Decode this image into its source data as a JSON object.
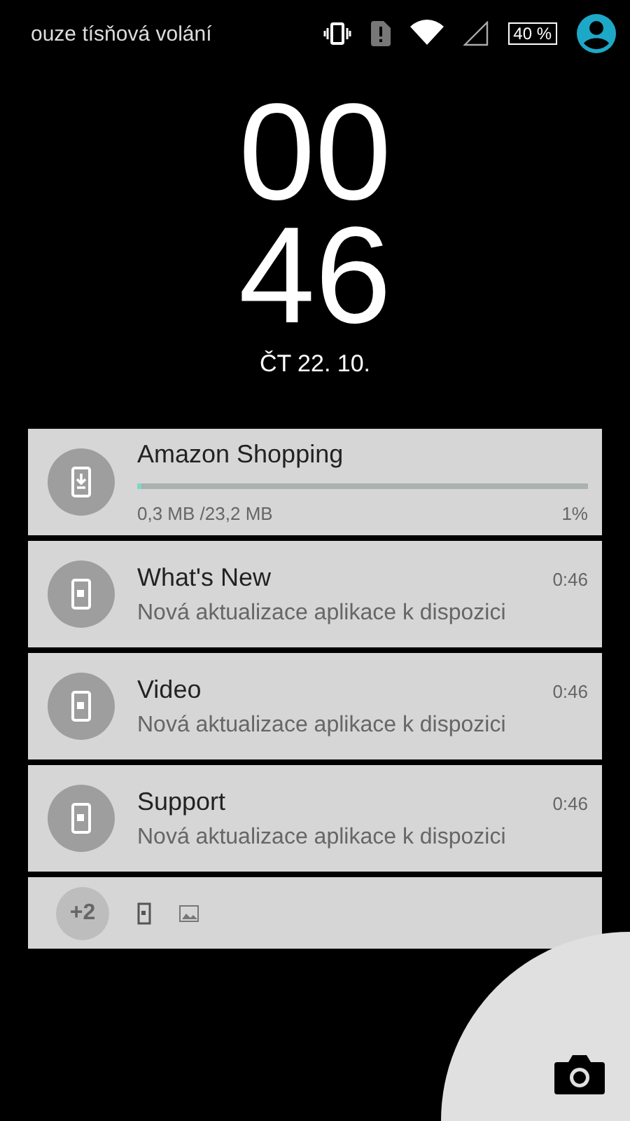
{
  "status_bar": {
    "carrier": "ouze tísňová volání",
    "battery": "40 %"
  },
  "clock": {
    "hours": "00",
    "minutes": "46",
    "date": "ČT 22. 10."
  },
  "notifications": [
    {
      "kind": "progress",
      "title": "Amazon Shopping",
      "detail": "0,3 MB /23,2 MB",
      "percent": "1%",
      "level": 0.01
    },
    {
      "kind": "message",
      "title": "What's New",
      "text": "Nová aktualizace aplikace k dispozici",
      "time": "0:46"
    },
    {
      "kind": "message",
      "title": "Video",
      "text": "Nová aktualizace aplikace k dispozici",
      "time": "0:46"
    },
    {
      "kind": "message",
      "title": "Support",
      "text": "Nová aktualizace aplikace k dispozici",
      "time": "0:46"
    }
  ],
  "summary": {
    "count": "+2"
  }
}
